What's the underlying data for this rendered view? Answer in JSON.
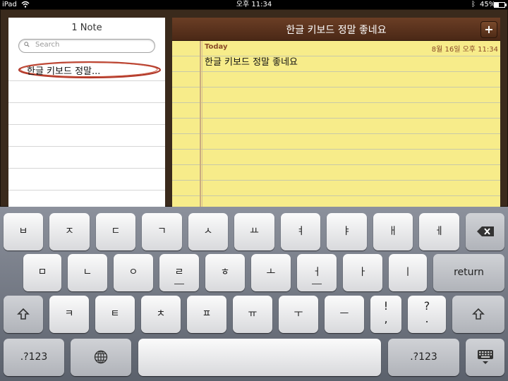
{
  "status": {
    "device": "iPad",
    "time": "오후 11:34",
    "battery": "45%",
    "battery_level": 0.45
  },
  "list": {
    "title": "1 Note",
    "search_placeholder": "Search",
    "items": [
      {
        "label": "한글 키보드 정말..."
      }
    ]
  },
  "note": {
    "title": "한글 키보드 정말 좋네요",
    "add_label": "+",
    "today": "Today",
    "date": "8월 16일  오후 11:34",
    "body": "한글 키보드 정말 좋네요"
  },
  "keyboard": {
    "row1": [
      "ㅂ",
      "ㅈ",
      "ㄷ",
      "ㄱ",
      "ㅅ",
      "ㅛ",
      "ㅕ",
      "ㅑ",
      "ㅐ",
      "ㅔ"
    ],
    "row2": [
      "ㅁ",
      "ㄴ",
      "ㅇ",
      "ㄹ",
      "ㅎ",
      "ㅗ",
      "ㅓ",
      "ㅏ",
      "ㅣ"
    ],
    "row3": [
      "ㅋ",
      "ㅌ",
      "ㅊ",
      "ㅍ",
      "ㅠ",
      "ㅜ",
      "ㅡ"
    ],
    "return": "return",
    "excl_top": "!",
    "excl_bottom": ",",
    "quest_top": "?",
    "quest_bottom": ".",
    "num_left": ".?123",
    "num_right": ".?123"
  }
}
